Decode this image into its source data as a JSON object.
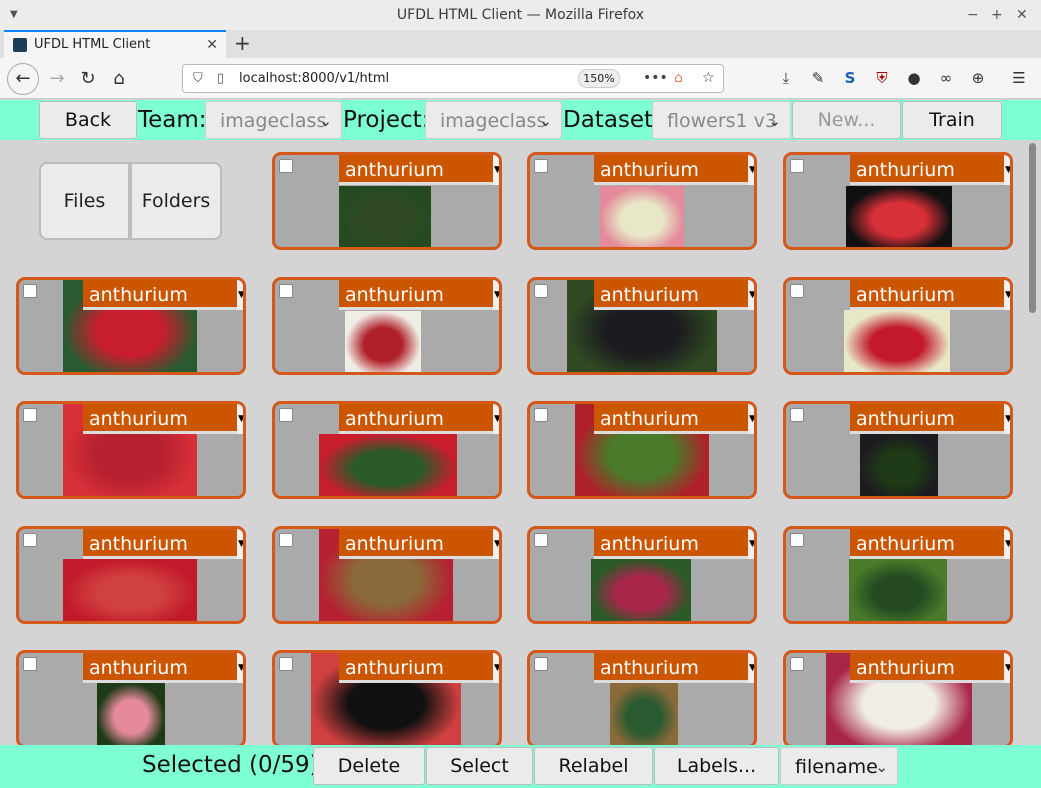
{
  "window": {
    "title": "UFDL HTML Client — Mozilla Firefox"
  },
  "tab": {
    "title": "UFDL HTML Client"
  },
  "address": {
    "url": "localhost:8000/v1/html",
    "zoom": "150%"
  },
  "toolbar": {
    "back_label": "Back",
    "team_label": "Team:",
    "team_value": "imageclass",
    "project_label": "Project:",
    "project_value": "imageclass",
    "dataset_label": "Dataset:",
    "dataset_value": "flowers1 v3",
    "new_label": "New...",
    "train_label": "Train"
  },
  "view_toggle": {
    "files_label": "Files",
    "folders_label": "Folders"
  },
  "cards": [
    {
      "label": "anthurium"
    },
    {
      "label": "anthurium"
    },
    {
      "label": "anthurium"
    },
    {
      "label": "anthurium"
    },
    {
      "label": "anthurium"
    },
    {
      "label": "anthurium"
    },
    {
      "label": "anthurium"
    },
    {
      "label": "anthurium"
    },
    {
      "label": "anthurium"
    },
    {
      "label": "anthurium"
    },
    {
      "label": "anthurium"
    },
    {
      "label": "anthurium"
    },
    {
      "label": "anthurium"
    },
    {
      "label": "anthurium"
    },
    {
      "label": "anthurium"
    },
    {
      "label": "anthurium"
    },
    {
      "label": "anthurium"
    },
    {
      "label": "anthurium"
    },
    {
      "label": "anthurium"
    }
  ],
  "footer": {
    "selected_text": "Selected (0/59)",
    "delete_label": "Delete",
    "select_label": "Select",
    "relabel_label": "Relabel",
    "labels_label": "Labels...",
    "sort_value": "filename"
  },
  "colors": {
    "accent": "#7fffd4",
    "card_border": "#d4581a",
    "label_bg": "#cc5500"
  }
}
